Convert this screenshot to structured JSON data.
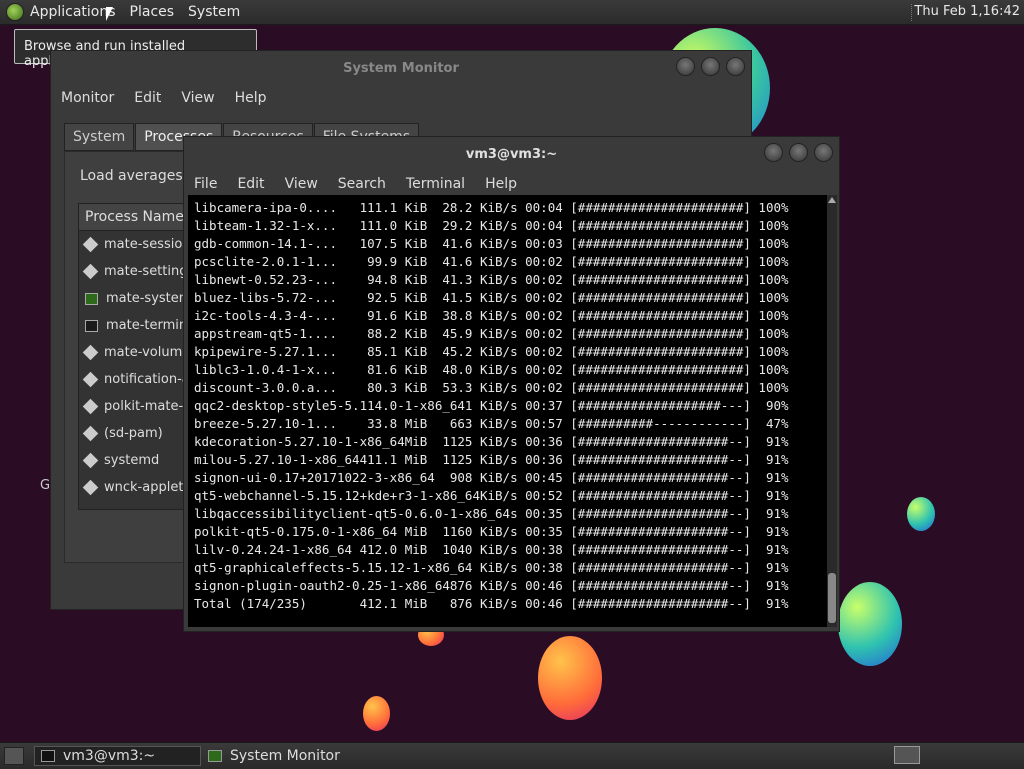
{
  "top_panel": {
    "menus": [
      "Applications",
      "Places",
      "System"
    ],
    "clock": "Thu Feb  1,16:42"
  },
  "tooltip": "Browse and run installed applications",
  "system_monitor": {
    "title": "System Monitor",
    "menus": [
      "Monitor",
      "Edit",
      "View",
      "Help"
    ],
    "tabs": [
      "System",
      "Processes",
      "Resources",
      "File Systems"
    ],
    "load_averages": "Load averages fo",
    "process_header": "Process Name",
    "processes": [
      "mate-session",
      "mate-setting",
      "mate-system",
      "mate-termina",
      "mate-volume",
      "notification-a",
      "polkit-mate-a",
      "(sd-pam)",
      "systemd",
      "wnck-applet"
    ],
    "g_text": "G"
  },
  "terminal": {
    "title": "vm3@vm3:~",
    "menus": [
      "File",
      "Edit",
      "View",
      "Search",
      "Terminal",
      "Help"
    ],
    "lines": [
      "libcamera-ipa-0....   111.1 KiB  28.2 KiB/s 00:04 [######################] 100%",
      "libteam-1.32-1-x...   111.0 KiB  29.2 KiB/s 00:04 [######################] 100%",
      "gdb-common-14.1-...   107.5 KiB  41.6 KiB/s 00:03 [######################] 100%",
      "pcsclite-2.0.1-1...    99.9 KiB  41.6 KiB/s 00:02 [######################] 100%",
      "libnewt-0.52.23-...    94.8 KiB  41.3 KiB/s 00:02 [######################] 100%",
      "bluez-libs-5.72-...    92.5 KiB  41.5 KiB/s 00:02 [######################] 100%",
      "i2c-tools-4.3-4-...    91.6 KiB  38.8 KiB/s 00:02 [######################] 100%",
      "appstream-qt5-1....    88.2 KiB  45.9 KiB/s 00:02 [######################] 100%",
      "kpipewire-5.27.1...    85.1 KiB  45.2 KiB/s 00:02 [######################] 100%",
      "liblc3-1.0.4-1-x...    81.6 KiB  48.0 KiB/s 00:02 [######################] 100%",
      "discount-3.0.0.a...    80.3 KiB  53.3 KiB/s 00:02 [######################] 100%",
      "qqc2-desktop-style5-5.114.0-1-x86_641 KiB/s 00:37 [###################---]  90%",
      "breeze-5.27.10-1...    33.8 MiB   663 KiB/s 00:57 [##########------------]  47%",
      "kdecoration-5.27.10-1-x86_64MiB  1125 KiB/s 00:36 [####################--]  91%",
      "milou-5.27.10-1-x86_64411.1 MiB  1125 KiB/s 00:36 [####################--]  91%",
      "signon-ui-0.17+20171022-3-x86_64  908 KiB/s 00:45 [####################--]  91%",
      "qt5-webchannel-5.15.12+kde+r3-1-x86_64KiB/s 00:52 [####################--]  91%",
      "libqaccessibilityclient-qt5-0.6.0-1-x86_64s 00:35 [####################--]  91%",
      "polkit-qt5-0.175.0-1-x86_64 MiB  1160 KiB/s 00:35 [####################--]  91%",
      "lilv-0.24.24-1-x86_64 412.0 MiB  1040 KiB/s 00:38 [####################--]  91%",
      "qt5-graphicaleffects-5.15.12-1-x86_64 KiB/s 00:38 [####################--]  91%",
      "signon-plugin-oauth2-0.25-1-x86_64876 KiB/s 00:46 [####################--]  91%",
      "Total (174/235)       412.1 MiB   876 KiB/s 00:46 [####################--]  91%"
    ]
  },
  "taskbar": {
    "tasks": [
      "vm3@vm3:~",
      "System Monitor"
    ]
  },
  "colors": {
    "desktop_bg": "#2a0d24",
    "terminal_bg": "#000000",
    "panel_bg": "#333333"
  }
}
